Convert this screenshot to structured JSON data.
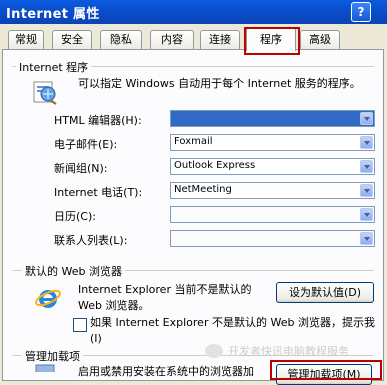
{
  "window": {
    "title": "Internet 属性",
    "help_glyph": "?"
  },
  "tabs": [
    "常规",
    "安全",
    "隐私",
    "内容",
    "连接",
    "程序",
    "高级"
  ],
  "programs_group": {
    "label": "Internet 程序",
    "description": "可以指定 Windows 自动用于每个 Internet 服务的程序。",
    "rows": [
      {
        "label": "HTML 编辑器(H):",
        "value": ""
      },
      {
        "label": "电子邮件(E):",
        "value": "Foxmail"
      },
      {
        "label": "新闻组(N):",
        "value": "Outlook Express"
      },
      {
        "label": "Internet 电话(T):",
        "value": "NetMeeting"
      },
      {
        "label": "日历(C):",
        "value": ""
      },
      {
        "label": "联系人列表(L):",
        "value": ""
      }
    ]
  },
  "browser_group": {
    "label": "默认的 Web 浏览器",
    "status_text": "Internet Explorer 当前不是默认的 Web 浏览器。",
    "set_default_button": "设为默认值(D)",
    "check_label": "如果 Internet Explorer 不是默认的 Web 浏览器，提示我(I)"
  },
  "addons_group": {
    "label": "管理加载项",
    "text": "启用或禁用安装在系统中的浏览器加",
    "manage_button": "管理加载项(M)"
  },
  "watermark": "开发者快讯电脑教程服务"
}
